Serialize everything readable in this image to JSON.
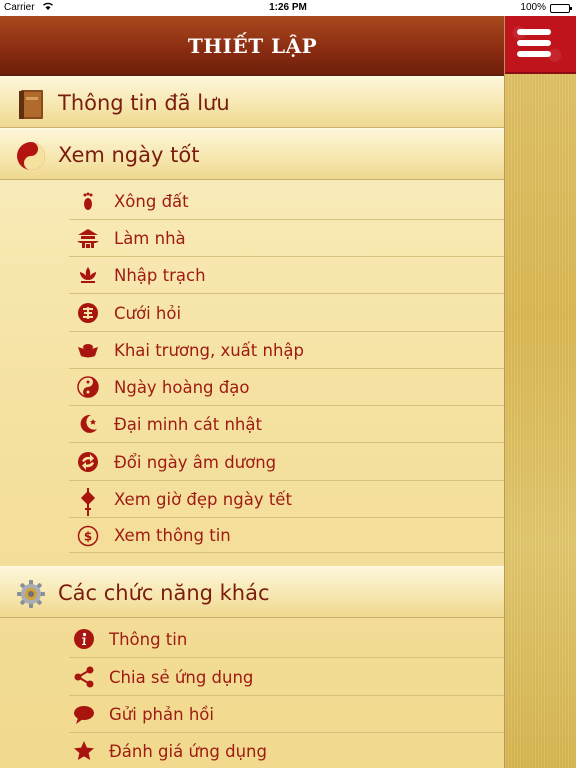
{
  "status_bar": {
    "carrier": "Carrier",
    "time": "1:26 PM",
    "battery": "100%"
  },
  "header": {
    "title": "THIẾT LẬP"
  },
  "sections": {
    "saved": {
      "label": "Thông tin đã lưu",
      "icon": "book-icon"
    },
    "good_days": {
      "label": "Xem ngày tốt",
      "icon": "yin-yang-icon"
    },
    "other": {
      "label": "Các chức năng khác",
      "icon": "gear-icon"
    }
  },
  "good_days_items": [
    {
      "label": "Xông đất",
      "icon": "footprint-icon"
    },
    {
      "label": "Làm nhà",
      "icon": "pagoda-icon"
    },
    {
      "label": "Nhập trạch",
      "icon": "lotus-icon"
    },
    {
      "label": "Cưới hỏi",
      "icon": "double-happiness-icon"
    },
    {
      "label": "Khai trương, xuất nhập",
      "icon": "gold-ingot-icon"
    },
    {
      "label": "Ngày hoàng đạo",
      "icon": "yin-yang-small-icon"
    },
    {
      "label": "Đại minh cát nhật",
      "icon": "moon-star-icon"
    },
    {
      "label": "Đổi ngày âm dương",
      "icon": "swap-icon"
    },
    {
      "label": "Xem giờ đẹp ngày tết",
      "icon": "knot-icon"
    },
    {
      "label": "Xem thông tin",
      "icon": "coin-icon"
    }
  ],
  "other_items": [
    {
      "label": "Thông tin",
      "icon": "info-icon"
    },
    {
      "label": "Chia sẻ ứng dụng",
      "icon": "share-icon"
    },
    {
      "label": "Gửi phản hồi",
      "icon": "chat-bubble-icon"
    },
    {
      "label": "Đánh giá ứng dụng",
      "icon": "star-icon"
    }
  ],
  "colors": {
    "header": "#8b2d12",
    "text": "#9e1a12",
    "hamburger_bg": "#c0141c"
  }
}
